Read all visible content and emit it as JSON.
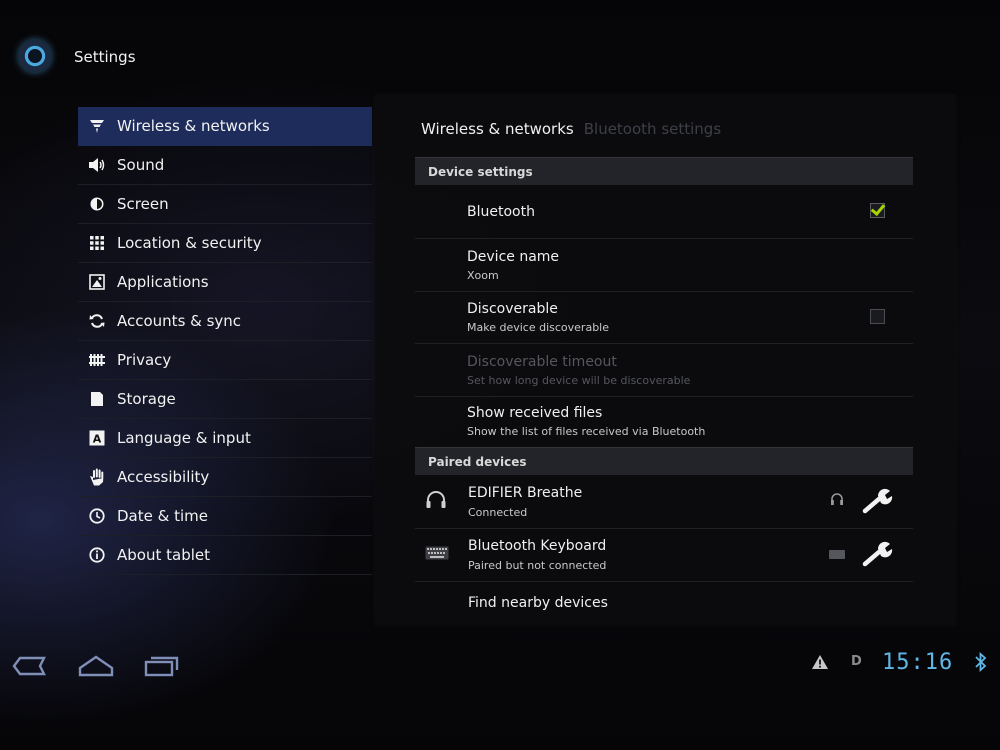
{
  "app": {
    "title": "Settings"
  },
  "menu": {
    "items": [
      {
        "label": "Wireless & networks",
        "icon": "wifi-icon",
        "active": true
      },
      {
        "label": "Sound",
        "icon": "speaker-icon"
      },
      {
        "label": "Screen",
        "icon": "brightness-icon"
      },
      {
        "label": "Location & security",
        "icon": "grid-icon"
      },
      {
        "label": "Applications",
        "icon": "apps-icon"
      },
      {
        "label": "Accounts & sync",
        "icon": "sync-icon"
      },
      {
        "label": "Privacy",
        "icon": "privacy-icon"
      },
      {
        "label": "Storage",
        "icon": "storage-icon"
      },
      {
        "label": "Language & input",
        "icon": "language-icon"
      },
      {
        "label": "Accessibility",
        "icon": "hand-icon"
      },
      {
        "label": "Date & time",
        "icon": "clock-icon"
      },
      {
        "label": "About tablet",
        "icon": "info-icon"
      }
    ]
  },
  "breadcrumb": {
    "active": "Wireless & networks",
    "current": "Bluetooth settings"
  },
  "device_settings": {
    "header": "Device settings",
    "bluetooth": {
      "title": "Bluetooth",
      "checked": true
    },
    "device_name": {
      "title": "Device name",
      "value": "Xoom"
    },
    "discoverable": {
      "title": "Discoverable",
      "summary": "Make device discoverable",
      "checked": false
    },
    "timeout": {
      "title": "Discoverable timeout",
      "summary": "Set how long device will be discoverable"
    },
    "received": {
      "title": "Show received files",
      "summary": "Show the list of files received via Bluetooth"
    }
  },
  "paired": {
    "header": "Paired devices",
    "devices": [
      {
        "name": "EDIFIER Breathe",
        "status": "Connected",
        "icon": "headphones-icon"
      },
      {
        "name": "Bluetooth Keyboard",
        "status": "Paired but not connected",
        "icon": "keyboard-icon"
      }
    ],
    "find": "Find nearby devices"
  },
  "status": {
    "time": "15:16",
    "notification": "D"
  },
  "colors": {
    "accent": "#5fb7e8",
    "selected": "#1d2c5a",
    "check": "#a8d400"
  }
}
